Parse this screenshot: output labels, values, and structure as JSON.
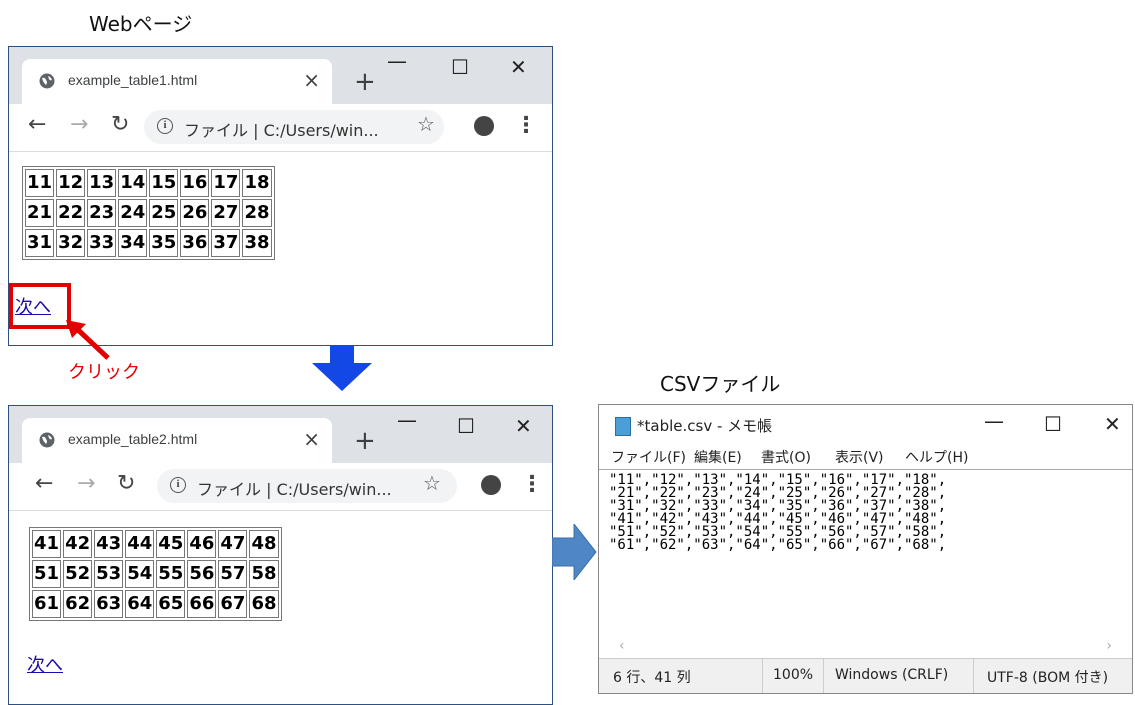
{
  "captions": {
    "webpage": "Webページ",
    "csv": "CSVファイル",
    "click": "クリック"
  },
  "browser1": {
    "tab_title": "example_table1.html",
    "address": "ファイル | C:/Users/win...",
    "rows": [
      [
        "11",
        "12",
        "13",
        "14",
        "15",
        "16",
        "17",
        "18"
      ],
      [
        "21",
        "22",
        "23",
        "24",
        "25",
        "26",
        "27",
        "28"
      ],
      [
        "31",
        "32",
        "33",
        "34",
        "35",
        "36",
        "37",
        "38"
      ]
    ],
    "link": "次へ"
  },
  "browser2": {
    "tab_title": "example_table2.html",
    "address": "ファイル | C:/Users/win...",
    "rows": [
      [
        "41",
        "42",
        "43",
        "44",
        "45",
        "46",
        "47",
        "48"
      ],
      [
        "51",
        "52",
        "53",
        "54",
        "55",
        "56",
        "57",
        "58"
      ],
      [
        "61",
        "62",
        "63",
        "64",
        "65",
        "66",
        "67",
        "68"
      ]
    ],
    "link": "次へ"
  },
  "notepad": {
    "title": "*table.csv - メモ帳",
    "menu": [
      "ファイル(F)",
      "編集(E)",
      "書式(O)",
      "表示(V)",
      "ヘルプ(H)"
    ],
    "lines": [
      "\"11\",\"12\",\"13\",\"14\",\"15\",\"16\",\"17\",\"18\",",
      "\"21\",\"22\",\"23\",\"24\",\"25\",\"26\",\"27\",\"28\",",
      "\"31\",\"32\",\"33\",\"34\",\"35\",\"36\",\"37\",\"38\",",
      "\"41\",\"42\",\"43\",\"44\",\"45\",\"46\",\"47\",\"48\",",
      "\"51\",\"52\",\"53\",\"54\",\"55\",\"56\",\"57\",\"58\",",
      "\"61\",\"62\",\"63\",\"64\",\"65\",\"66\",\"67\",\"68\","
    ],
    "status": {
      "position": "6 行、41 列",
      "zoom": "100%",
      "line_ending": "Windows (CRLF)",
      "encoding": "UTF-8 (BOM 付き)"
    }
  },
  "icons": {
    "minimize": "minimize-icon",
    "maximize": "maximize-icon",
    "close": "close-icon",
    "back": "back-arrow-icon",
    "forward": "forward-arrow-icon",
    "reload": "reload-icon",
    "info": "info-icon",
    "star": "star-icon",
    "profile": "profile-icon",
    "menu": "kebab-menu-icon",
    "globe": "globe-icon"
  },
  "colors": {
    "highlight": "#e30000",
    "arrow": "#1448e6",
    "csv_arrow": "#4f86c6",
    "link": "#1a0dab"
  }
}
